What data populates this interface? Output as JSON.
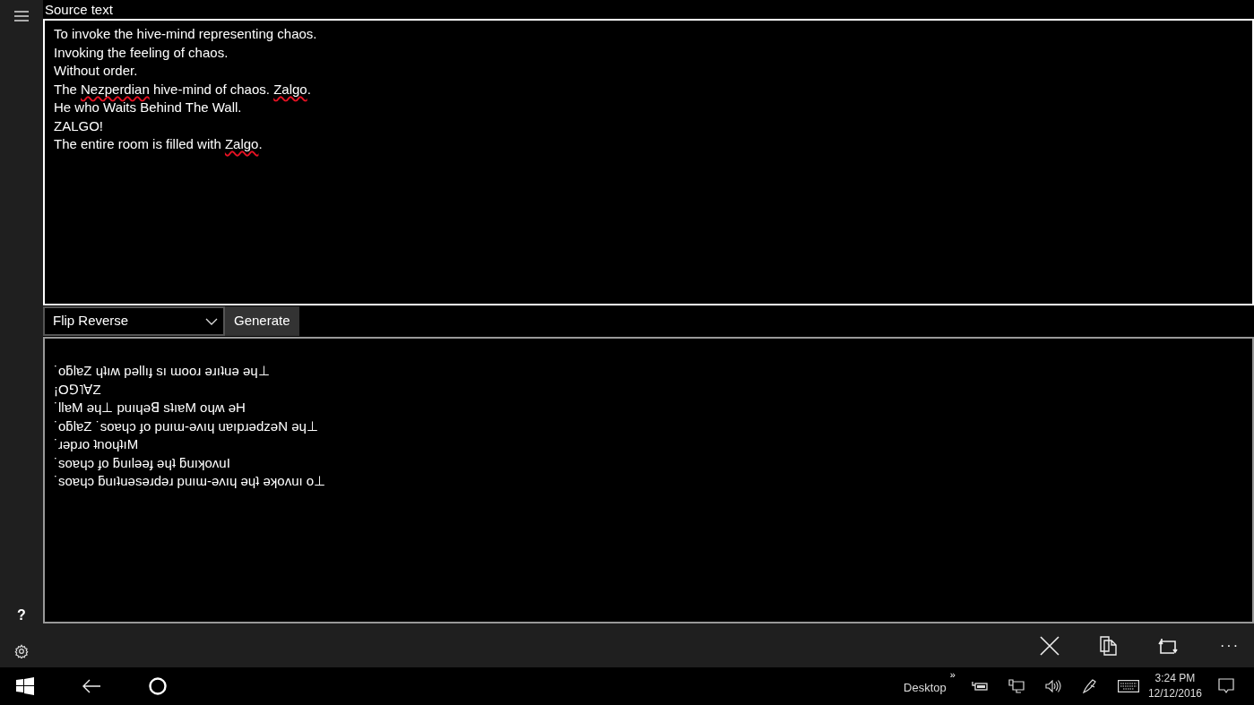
{
  "source": {
    "label": "Source text",
    "lines": [
      [
        {
          "text": "To invoke the hive-mind representing chaos."
        }
      ],
      [
        {
          "text": "Invoking the feeling of chaos."
        }
      ],
      [
        {
          "text": "Without order."
        }
      ],
      [
        {
          "text": "The "
        },
        {
          "text": "Nezperdian",
          "misspelled": true
        },
        {
          "text": " hive-mind of chaos. "
        },
        {
          "text": "Zalgo",
          "misspelled": true
        },
        {
          "text": "."
        }
      ],
      [
        {
          "text": "He who Waits Behind The Wall."
        }
      ],
      [
        {
          "text": "ZALGO!"
        }
      ],
      [
        {
          "text": "The entire room is filled with "
        },
        {
          "text": "Zalgo",
          "misspelled": true
        },
        {
          "text": "."
        }
      ]
    ]
  },
  "mode": {
    "value": "Flip Reverse"
  },
  "generate_button": "Generate",
  "output": {
    "lines": [
      "˙oƃlɐZ ɥʇıʍ pǝllıɟ sı ɯooɹ ǝɹıʇuǝ ǝɥ⊥",
      "¡O⅁˥∀Z",
      "˙llɐM ǝɥ⊥ puıɥǝꓭ sʇıɐM oɥʍ ǝH",
      "˙oƃlɐZ ˙soɐɥɔ ɟo puıɯ-ǝʌıɥ uɐıpɹǝdzǝN ǝɥ⊥",
      "˙ɹǝpɹo ʇnoɥʇıM",
      "˙soɐɥɔ ɟo ƃuılǝǝɟ ǝɥʇ ƃuıʞoʌuI",
      "˙soɐɥɔ ƃuıʇuǝsǝɹdǝɹ puıɯ-ǝʌıɥ ǝɥʇ ǝʞoʌuı o⊥"
    ]
  },
  "sidebar": {
    "help": "?"
  },
  "command_bar": {
    "more": "···"
  },
  "taskbar": {
    "desktop": "Desktop",
    "chevron": "»",
    "time": "3:24 PM",
    "date": "12/12/2016"
  }
}
